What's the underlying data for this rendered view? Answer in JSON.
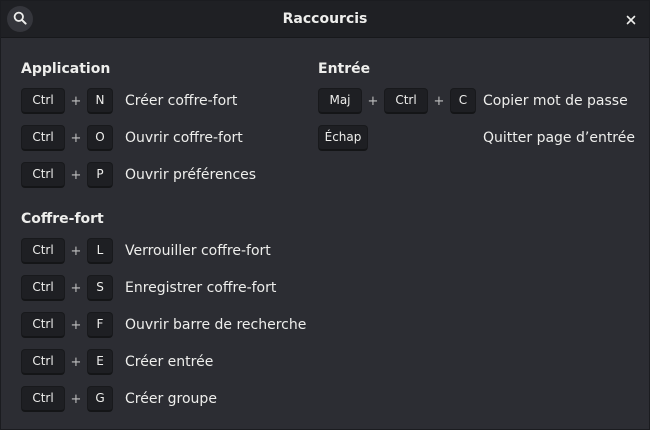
{
  "window": {
    "title": "Raccourcis"
  },
  "icons": {
    "search": "search-icon",
    "close": "close-icon"
  },
  "plus_sign": "+",
  "sections": {
    "application": {
      "title": "Application",
      "shortcuts": [
        {
          "keys": [
            "Ctrl",
            "N"
          ],
          "label": "Créer coffre-fort"
        },
        {
          "keys": [
            "Ctrl",
            "O"
          ],
          "label": "Ouvrir coffre-fort"
        },
        {
          "keys": [
            "Ctrl",
            "P"
          ],
          "label": "Ouvrir préférences"
        }
      ]
    },
    "vault": {
      "title": "Coffre-fort",
      "shortcuts": [
        {
          "keys": [
            "Ctrl",
            "L"
          ],
          "label": "Verrouiller coffre-fort"
        },
        {
          "keys": [
            "Ctrl",
            "S"
          ],
          "label": "Enregistrer coffre-fort"
        },
        {
          "keys": [
            "Ctrl",
            "F"
          ],
          "label": "Ouvrir barre de recherche"
        },
        {
          "keys": [
            "Ctrl",
            "E"
          ],
          "label": "Créer entrée"
        },
        {
          "keys": [
            "Ctrl",
            "G"
          ],
          "label": "Créer groupe"
        }
      ]
    },
    "entry": {
      "title": "Entrée",
      "shortcuts": [
        {
          "keys": [
            "Maj",
            "Ctrl",
            "C"
          ],
          "label": "Copier mot de passe"
        },
        {
          "keys": [
            "Échap"
          ],
          "label": "Quitter page d’entrée"
        }
      ]
    }
  },
  "colors": {
    "background": "#2c2d33",
    "headerbar": "#1f2024",
    "key_background": "#1e1f23",
    "text": "#eeeeec"
  }
}
